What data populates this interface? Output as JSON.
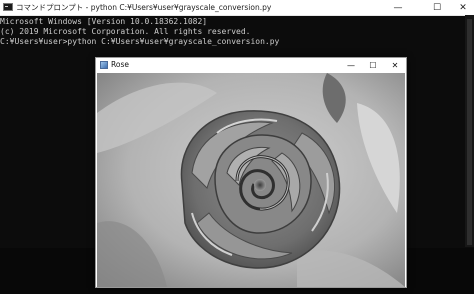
{
  "console": {
    "title": "コマンドプロンプト - python  C:¥Users¥user¥grayscale_conversion.py",
    "lines": [
      "Microsoft Windows [Version 10.0.18362.1082]",
      "(c) 2019 Microsoft Corporation. All rights reserved.",
      "",
      "C:¥Users¥user>python C:¥Users¥user¥grayscale_conversion.py"
    ],
    "buttons": {
      "minimize": "—",
      "maximize": "☐",
      "close": "✕"
    }
  },
  "image_window": {
    "title": "Rose",
    "buttons": {
      "minimize": "—",
      "maximize": "☐",
      "close": "✕"
    },
    "image_subject": "grayscale photo of a rose"
  }
}
